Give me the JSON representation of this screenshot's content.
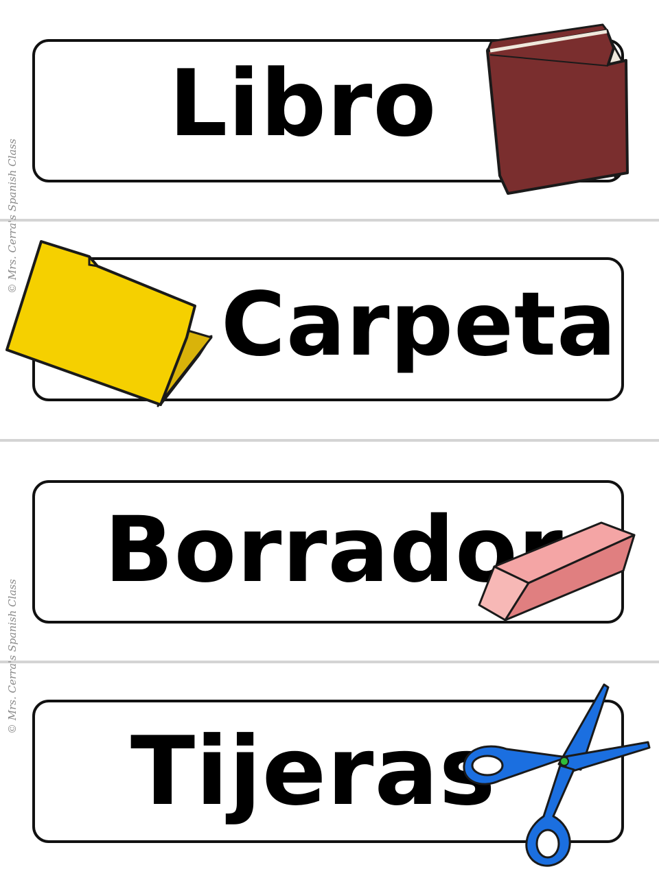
{
  "cards": [
    {
      "word": "Libro",
      "image": "book-icon"
    },
    {
      "word": "Carpeta",
      "image": "folder-icon"
    },
    {
      "word": "Borrador",
      "image": "eraser-icon"
    },
    {
      "word": "Tijeras",
      "image": "scissors-icon"
    }
  ],
  "watermark": "© Mrs. Cerra's Spanish Class",
  "colors": {
    "book": "#7a2e2e",
    "book_pages": "#efe8dc",
    "folder": "#f5d000",
    "folder_inner": "#e0bb10",
    "eraser_top": "#f4a5a5",
    "eraser_side": "#e07f80",
    "scissors": "#1b6fe0",
    "scissors_pivot": "#2fbd3a",
    "divider": "#d4d4d4"
  }
}
